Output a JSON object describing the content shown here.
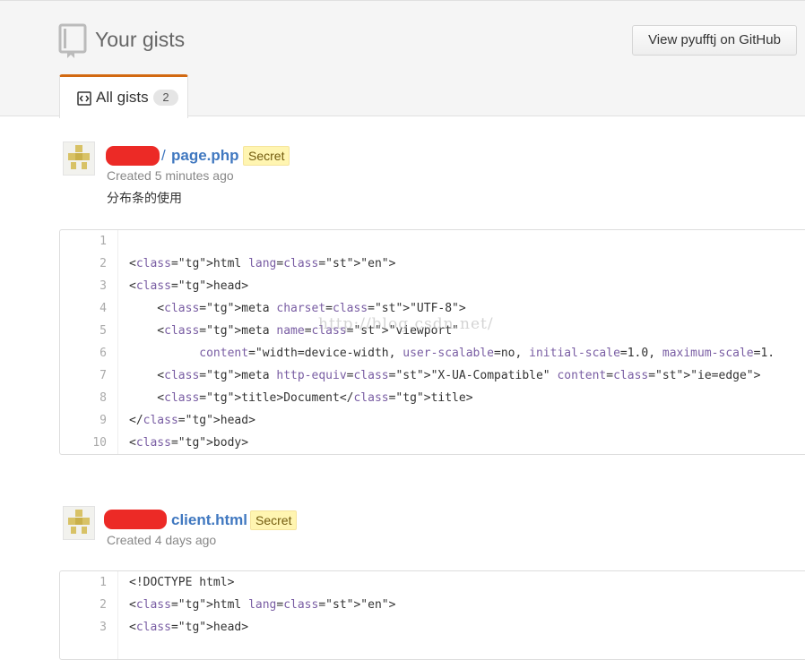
{
  "header": {
    "title": "Your gists",
    "view_button": "View pyufftj on GitHub",
    "tab": {
      "label": "All gists",
      "count": "2"
    }
  },
  "gists": [
    {
      "separator": "/",
      "name": "page.php",
      "badge": "Secret",
      "created": "Created 5 minutes ago",
      "description": "分布条的使用",
      "code": [
        {
          "n": "1",
          "t": ""
        },
        {
          "n": "2",
          "t": "<html lang=\"en\">"
        },
        {
          "n": "3",
          "t": "<head>"
        },
        {
          "n": "4",
          "t": "    <meta charset=\"UTF-8\">"
        },
        {
          "n": "5",
          "t": "    <meta name=\"viewport\""
        },
        {
          "n": "6",
          "t": "          content=\"width=device-width, user-scalable=no, initial-scale=1.0, maximum-scale=1."
        },
        {
          "n": "7",
          "t": "    <meta http-equiv=\"X-UA-Compatible\" content=\"ie=edge\">"
        },
        {
          "n": "8",
          "t": "    <title>Document</title>"
        },
        {
          "n": "9",
          "t": "</head>"
        },
        {
          "n": "10",
          "t": "<body>"
        }
      ]
    },
    {
      "separator": "",
      "name": "client.html",
      "badge": "Secret",
      "created": "Created 4 days ago",
      "description": "",
      "code": [
        {
          "n": "1",
          "t": "<!DOCTYPE html>"
        },
        {
          "n": "2",
          "t": "<html lang=\"en\">"
        },
        {
          "n": "3",
          "t": "<head>"
        }
      ]
    }
  ],
  "watermark": "http://blog.csdn.net/",
  "colors": {
    "link": "#4078c0",
    "tab_accent": "#d26911",
    "badge_bg": "#fff5b1",
    "redaction": "#ec2a26"
  }
}
